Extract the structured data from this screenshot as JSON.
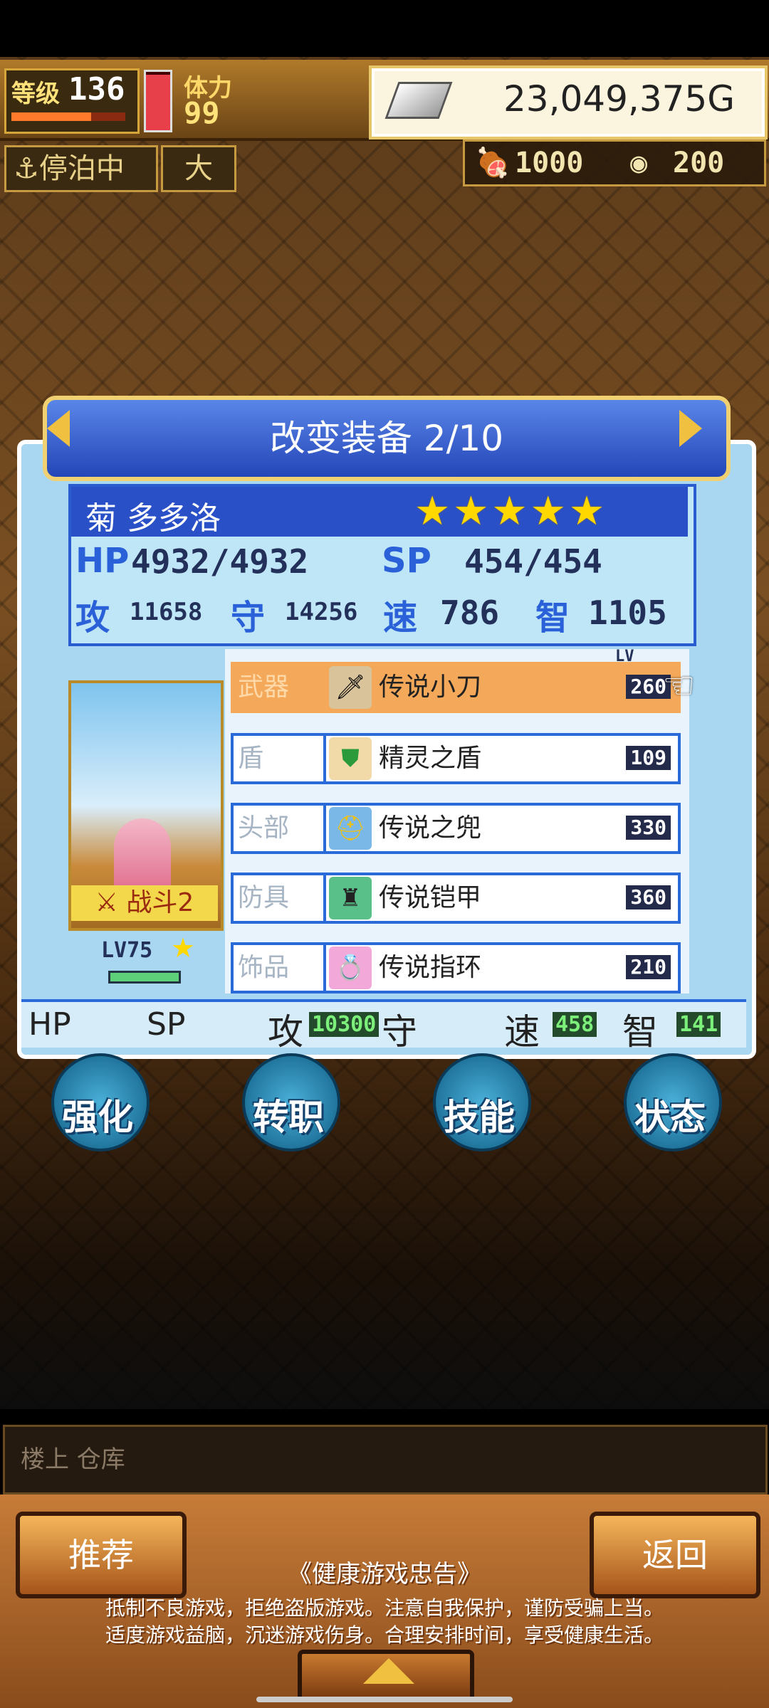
{
  "topbar": {
    "level_label": "等级",
    "level_value": "136",
    "level_progress": 0.7,
    "stamina_label": "体力",
    "stamina_value": "99",
    "stamina_fill": 0.95,
    "gold_value": "23,049,375G"
  },
  "status": {
    "dock_label": "⚓停泊中",
    "flag_label": "大",
    "resource_1": "1000",
    "resource_2": "200"
  },
  "dialog": {
    "title": "改变装备 2/10",
    "character": {
      "name": "菊 多多洛",
      "stars": "★★★★★",
      "hp_label": "HP",
      "hp_value": "4932/4932",
      "sp_label": "SP",
      "sp_value": "454/454",
      "atk_label": "攻",
      "atk_value": "11658",
      "def_label": "守",
      "def_value": "14256",
      "spd_label": "速",
      "spd_value": "786",
      "int_label": "智",
      "int_value": "1105",
      "job": "战斗2",
      "level": "LV75"
    },
    "equipment": [
      {
        "slot": "武器",
        "name": "传说小刀",
        "lv": "260",
        "icon": "dagger-icon"
      },
      {
        "slot": "盾",
        "name": "精灵之盾",
        "lv": "109",
        "icon": "shield-icon"
      },
      {
        "slot": "头部",
        "name": "传说之兜",
        "lv": "330",
        "icon": "helmet-icon"
      },
      {
        "slot": "防具",
        "name": "传说铠甲",
        "lv": "360",
        "icon": "armor-icon"
      },
      {
        "slot": "饰品",
        "name": "传说指环",
        "lv": "210",
        "icon": "ring-icon"
      }
    ],
    "lv_tag": "LV",
    "bottom_stats": {
      "hp_label": "HP",
      "sp_label": "SP",
      "atk_label": "攻",
      "atk_value": "10300",
      "def_label": "守",
      "spd_label": "速",
      "spd_value": "458",
      "int_label": "智",
      "int_value": "141"
    }
  },
  "actions": [
    "强化",
    "转职",
    "技能",
    "状态"
  ],
  "footer": {
    "location": "楼上 仓库",
    "recommend_label": "推荐",
    "back_label": "返回",
    "notice_title": "《健康游戏忠告》",
    "notice_line_1": "抵制不良游戏，拒绝盗版游戏。注意自我保护，谨防受骗上当。",
    "notice_line_2": "适度游戏益脑，沉迷游戏伤身。合理安排时间，享受健康生活。"
  },
  "colors": {
    "accent_blue": "#2a50c8",
    "selected_row": "#f3a85a",
    "gold": "#f0c040"
  }
}
